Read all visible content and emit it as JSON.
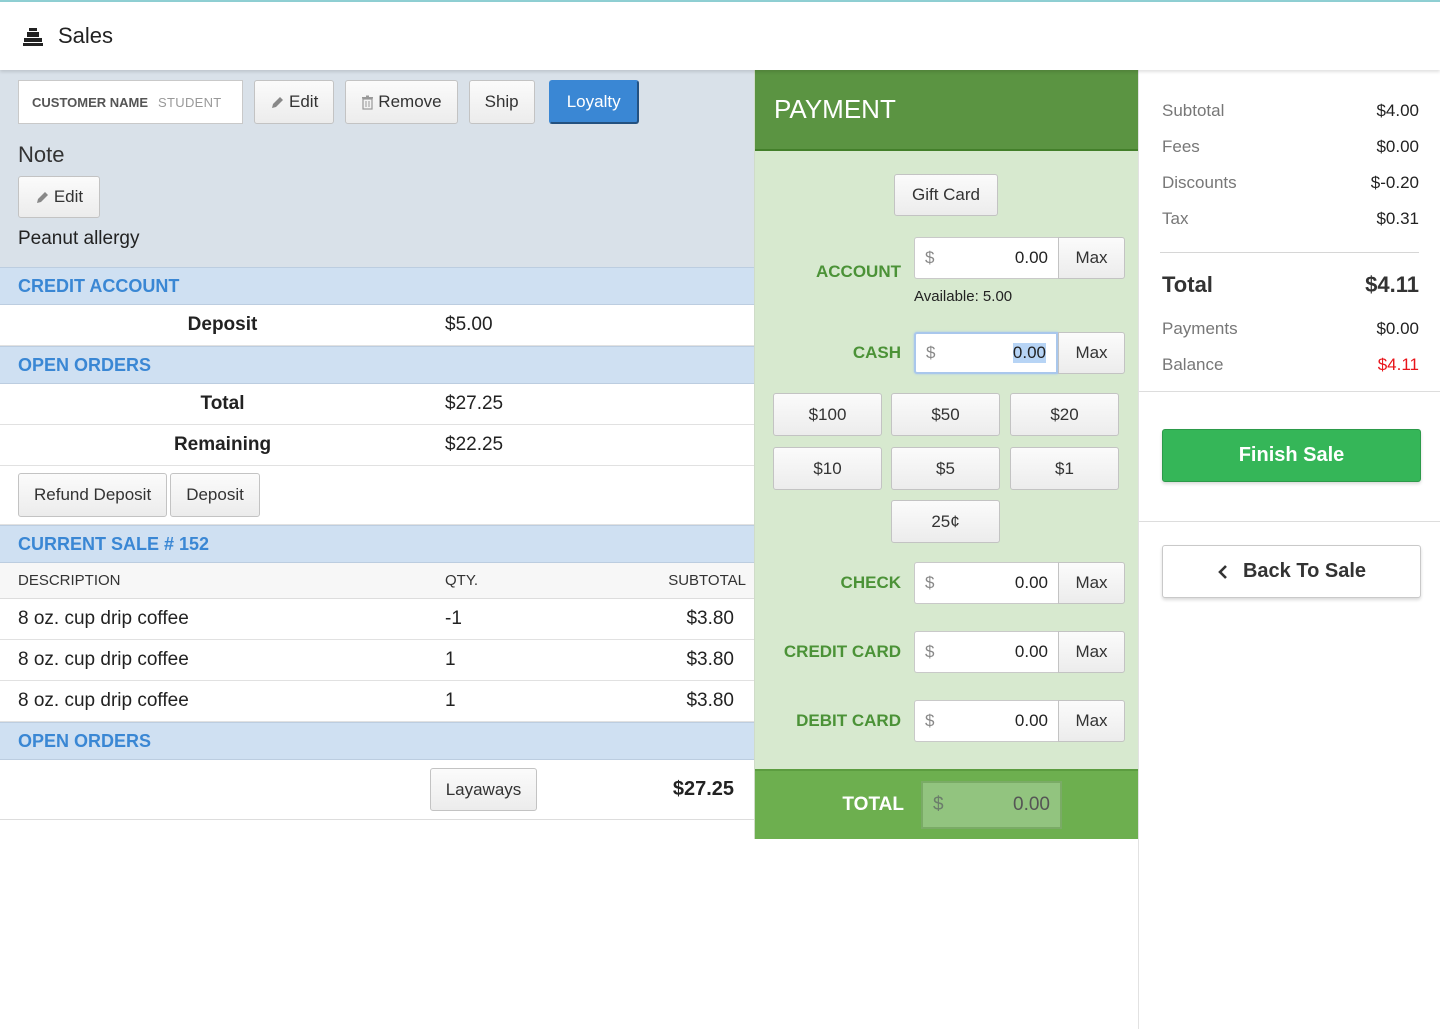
{
  "header": {
    "title": "Sales",
    "icon": "cash-register-icon"
  },
  "customer": {
    "name_label": "CUSTOMER NAME",
    "name_value": "STUDENT",
    "edit_label": "Edit",
    "remove_label": "Remove",
    "ship_label": "Ship",
    "loyalty_label": "Loyalty",
    "loyalty_color": "#3a87d4"
  },
  "note": {
    "label": "Note",
    "edit_label": "Edit",
    "text": "Peanut allergy"
  },
  "credit_account": {
    "heading": "CREDIT ACCOUNT",
    "deposit_label": "Deposit",
    "deposit_value": "$5.00"
  },
  "open_orders": {
    "heading": "OPEN ORDERS",
    "total_label": "Total",
    "total_value": "$27.25",
    "remaining_label": "Remaining",
    "remaining_value": "$22.25",
    "refund_deposit_label": "Refund Deposit",
    "deposit_button_label": "Deposit"
  },
  "current_sale": {
    "heading": "CURRENT SALE # 152",
    "columns": [
      "DESCRIPTION",
      "QTY.",
      "SUBTOTAL"
    ],
    "items": [
      {
        "description": "8 oz. cup drip coffee",
        "qty": "-1",
        "subtotal": "$3.80"
      },
      {
        "description": "8 oz. cup drip coffee",
        "qty": "1",
        "subtotal": "$3.80"
      },
      {
        "description": "8 oz. cup drip coffee",
        "qty": "1",
        "subtotal": "$3.80"
      }
    ]
  },
  "open_orders_footer": {
    "heading": "OPEN ORDERS",
    "layaways_label": "Layaways",
    "total": "$27.25"
  },
  "payment": {
    "heading": "PAYMENT",
    "gift_card_label": "Gift Card",
    "currency_symbol": "$",
    "max_label": "Max",
    "methods": [
      {
        "label": "ACCOUNT",
        "value": "0.00"
      },
      {
        "label": "CASH",
        "value": "0.00"
      },
      {
        "label": "CHECK",
        "value": "0.00"
      },
      {
        "label": "CREDIT CARD",
        "value": "0.00"
      },
      {
        "label": "DEBIT CARD",
        "value": "0.00"
      }
    ],
    "available_text": "Available: 5.00",
    "cash_buttons": [
      "$100",
      "$50",
      "$20",
      "$10",
      "$5",
      "$1",
      "25¢"
    ],
    "total_label": "TOTAL",
    "total_value": "0.00",
    "header_color": "#5b9442",
    "panel_color": "#d7e9cf"
  },
  "summary": {
    "rows": [
      {
        "label": "Subtotal",
        "value": "$4.00"
      },
      {
        "label": "Fees",
        "value": "$0.00"
      },
      {
        "label": "Discounts",
        "value": "$-0.20"
      },
      {
        "label": "Tax",
        "value": "$0.31"
      }
    ],
    "total_label": "Total",
    "total_value": "$4.11",
    "payments_label": "Payments",
    "payments_value": "$0.00",
    "balance_label": "Balance",
    "balance_value": "$4.11",
    "balance_color": "#e8141a",
    "finish_label": "Finish Sale",
    "finish_color": "#35b658",
    "back_label": "Back To Sale"
  }
}
